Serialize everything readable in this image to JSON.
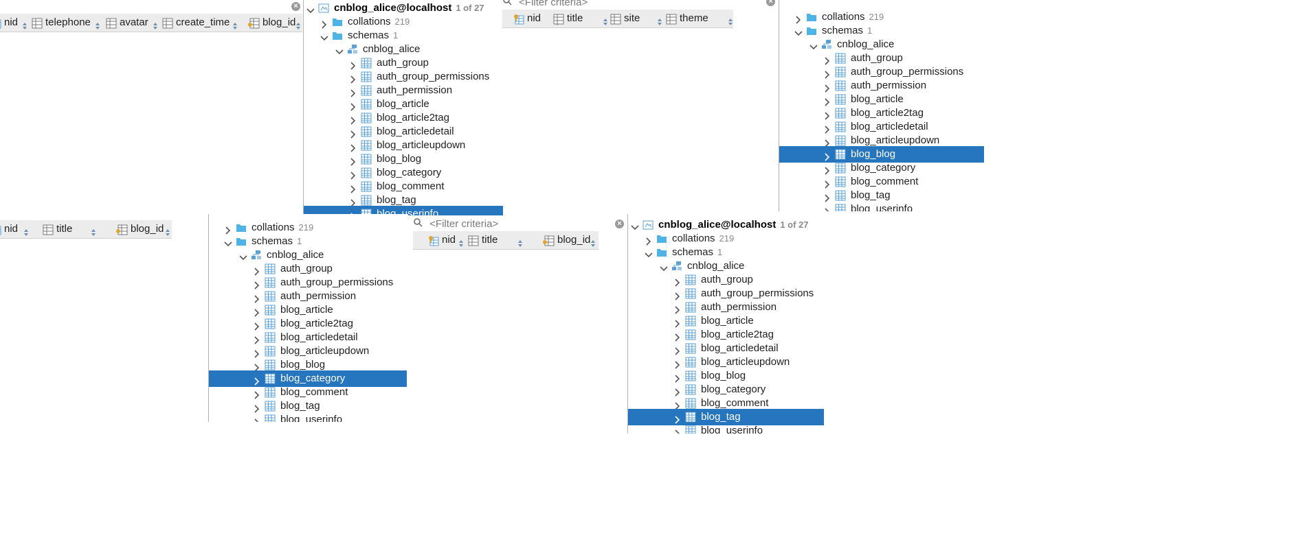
{
  "colors": {
    "selection": "#2675bf",
    "folder": "#4fb3e6",
    "table": "#5a9fd6",
    "key": "#e0a52e"
  },
  "tree": {
    "connection": "cnblog_alice@localhost",
    "connection_count": "1 of 27",
    "collations": "collations",
    "collations_count": "219",
    "schemas": "schemas",
    "schemas_count": "1",
    "schema": "cnblog_alice",
    "tables": [
      "auth_group",
      "auth_group_permissions",
      "auth_permission",
      "blog_article",
      "blog_article2tag",
      "blog_articledetail",
      "blog_articleupdown",
      "blog_blog",
      "blog_category",
      "blog_comment",
      "blog_tag",
      "blog_userinfo"
    ]
  },
  "filter_placeholder": "<Filter criteria>",
  "close_glyph": "×",
  "headers": {
    "userinfo": [
      "nid",
      "telephone",
      "avatar",
      "create_time",
      "blog_id"
    ],
    "blog": [
      "nid",
      "title",
      "site",
      "theme"
    ],
    "category": [
      "nid",
      "title",
      "blog_id"
    ],
    "tag": [
      "nid",
      "title",
      "blog_id"
    ]
  }
}
